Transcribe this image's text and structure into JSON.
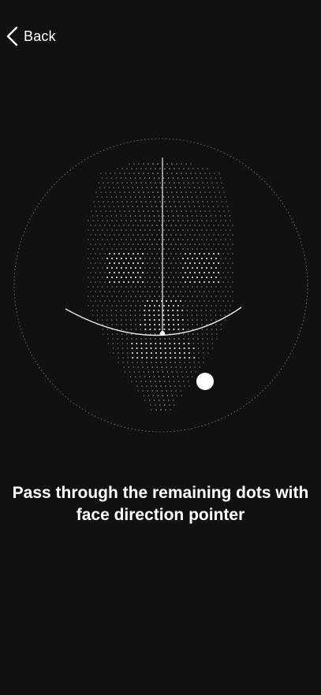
{
  "header": {
    "back_label": "Back",
    "back_icon": "chevron-left-icon"
  },
  "face_scan": {
    "icon": "face-mesh-icon",
    "guide_circle_color": "#6e6e6e",
    "mesh_color": "#d8d8d8",
    "pointer_color": "#ffffff",
    "target_dot_color": "#ffffff",
    "remaining_target_dots": 1
  },
  "instruction": {
    "text": "Pass through the remaining dots with face direction pointer"
  }
}
